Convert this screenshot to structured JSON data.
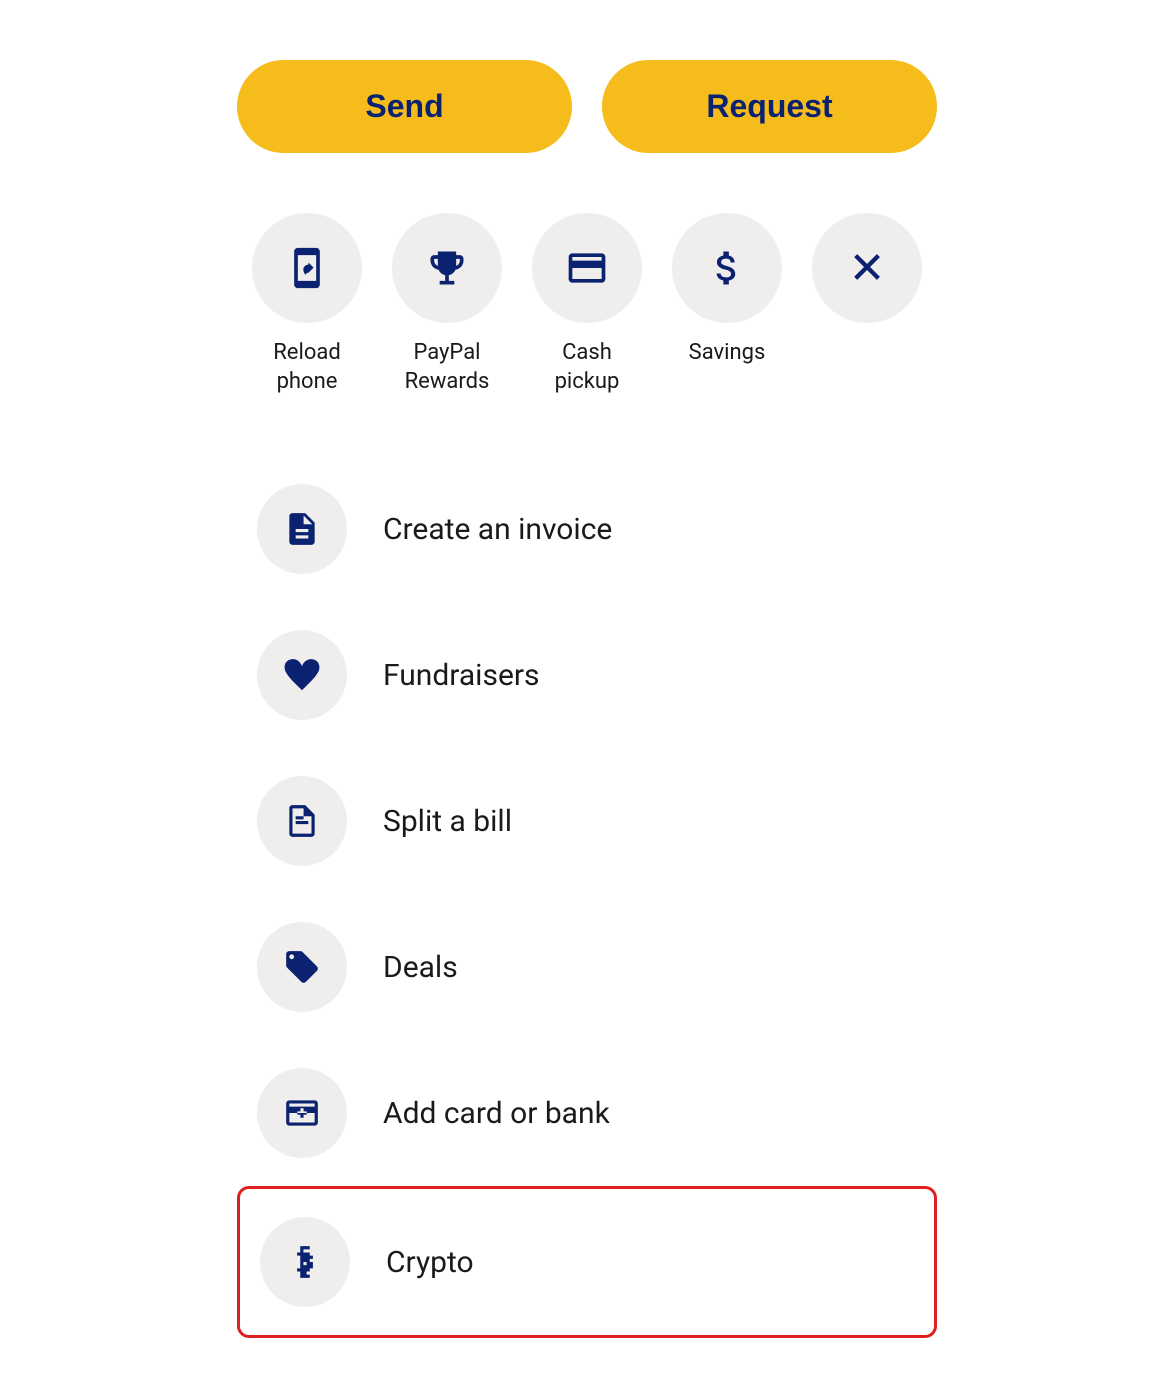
{
  "buttons": {
    "send_label": "Send",
    "request_label": "Request"
  },
  "quick_actions": [
    {
      "id": "reload-phone",
      "label": "Reload\nphone",
      "label_display": "Reload phone",
      "icon": "reload-phone-icon"
    },
    {
      "id": "paypal-rewards",
      "label": "PayPal\nRewards",
      "label_display": "PayPal Rewards",
      "icon": "trophy-icon"
    },
    {
      "id": "cash-pickup",
      "label": "Cash\npickup",
      "label_display": "Cash pickup",
      "icon": "cash-pickup-icon"
    },
    {
      "id": "savings",
      "label": "Savings",
      "label_display": "Savings",
      "icon": "savings-icon"
    },
    {
      "id": "close",
      "label": "",
      "label_display": "",
      "icon": "close-icon"
    }
  ],
  "list_items": [
    {
      "id": "create-invoice",
      "label": "Create an invoice",
      "icon": "invoice-icon",
      "highlighted": false
    },
    {
      "id": "fundraisers",
      "label": "Fundraisers",
      "icon": "fundraisers-icon",
      "highlighted": false
    },
    {
      "id": "split-bill",
      "label": "Split a bill",
      "icon": "split-bill-icon",
      "highlighted": false
    },
    {
      "id": "deals",
      "label": "Deals",
      "icon": "deals-icon",
      "highlighted": false
    },
    {
      "id": "add-card-bank",
      "label": "Add card or bank",
      "icon": "add-card-icon",
      "highlighted": false
    },
    {
      "id": "crypto",
      "label": "Crypto",
      "icon": "crypto-icon",
      "highlighted": true
    }
  ],
  "colors": {
    "brand_yellow": "#F5BC1C",
    "brand_navy": "#0a2270",
    "icon_bg": "#f0eeec",
    "highlight_border": "#e02020"
  }
}
